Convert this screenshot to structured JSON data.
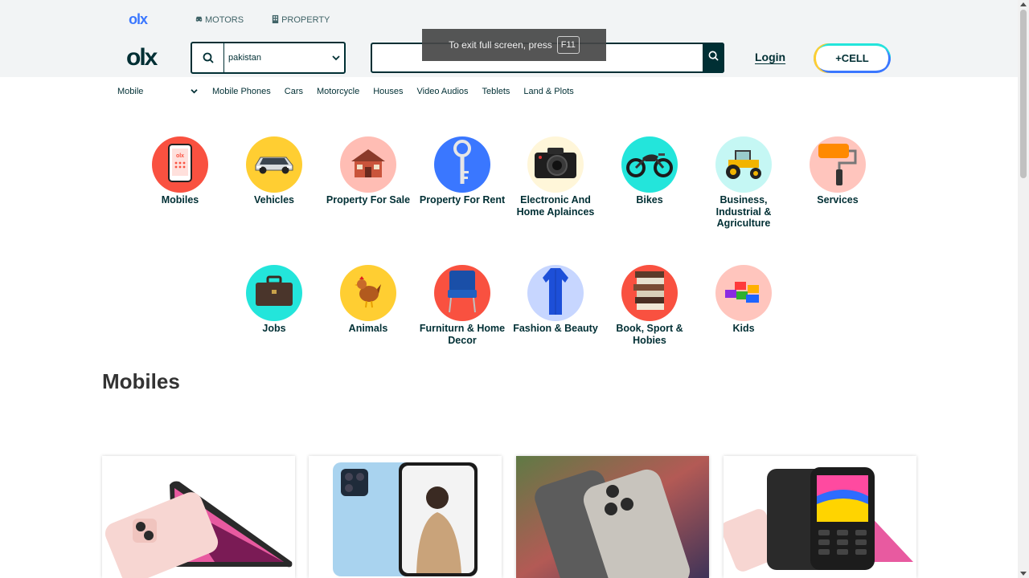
{
  "header": {
    "logo_small": "olx",
    "logo_big": "olx",
    "top_links": [
      {
        "label": "MOTORS",
        "icon": "car-icon"
      },
      {
        "label": "PROPERTY",
        "icon": "building-icon"
      }
    ],
    "location": {
      "value": "pakistan"
    },
    "search": {
      "placeholder": "",
      "value": ""
    },
    "login_label": "Login",
    "sell_label": "+CELL"
  },
  "toast": {
    "text": "To exit full screen, press",
    "key": "F11"
  },
  "category_bar": {
    "select_value": "Mobile",
    "links": [
      "Mobile Phones",
      "Cars",
      "Motorcycle",
      "Houses",
      "Video Audios",
      "Teblets",
      "Land & Plots"
    ]
  },
  "categories": [
    {
      "label": "Mobiles",
      "color": "#f95140"
    },
    {
      "label": "Vehicles",
      "color": "#ffce32"
    },
    {
      "label": "Property For Sale",
      "color": "#ffbdb4"
    },
    {
      "label": "Property For Rent",
      "color": "#3a77ff"
    },
    {
      "label": "Electronic And Home Aplainces",
      "color": "#fff6d9"
    },
    {
      "label": "Bikes",
      "color": "#23e5db"
    },
    {
      "label": "Business, Industrial & Agriculture",
      "color": "#c5f7f4"
    },
    {
      "label": "Services",
      "color": "#ffc5bd"
    },
    {
      "label": "Jobs",
      "color": "#23e5db"
    },
    {
      "label": "Animals",
      "color": "#ffce32"
    },
    {
      "label": "Furniturn & Home Decor",
      "color": "#f95140"
    },
    {
      "label": "Fashion & Beauty",
      "color": "#c7d6ff"
    },
    {
      "label": "Book, Sport & Hobies",
      "color": "#f95140"
    },
    {
      "label": "Kids",
      "color": "#ffc5bd"
    }
  ],
  "section": {
    "title": "Mobiles"
  }
}
